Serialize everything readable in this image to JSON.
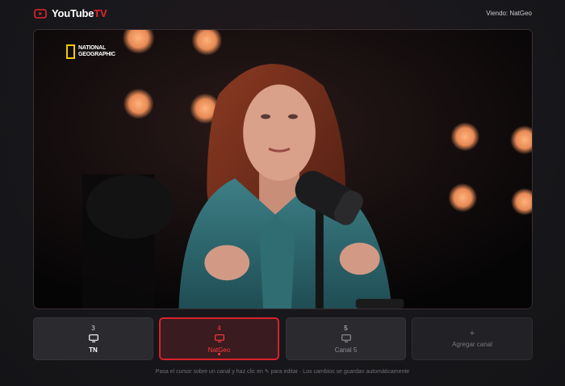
{
  "header": {
    "logo_main": "YouTube",
    "logo_accent": "TV",
    "now_viewing": "Viendo: NatGeo"
  },
  "player": {
    "channel_logo_line1": "NATIONAL",
    "channel_logo_line2": "GEOGRAPHIC"
  },
  "channels": [
    {
      "number": "3",
      "name": "TN",
      "icon": "tv-icon",
      "active": false
    },
    {
      "number": "4",
      "name": "NatGeo",
      "icon": "tv-icon",
      "active": true
    },
    {
      "number": "5",
      "name": "Canal 5",
      "icon": "tv-icon",
      "active": false
    }
  ],
  "add_channel": {
    "symbol": "+",
    "label": "Agregar canal"
  },
  "hint": "Pasa el cursor sobre un canal y haz clic en ✎ para editar · Los cambios se guardan automáticamente",
  "colors": {
    "accent": "#e4262b",
    "background": "#1a1a1e",
    "card": "#2a2a2f",
    "natgeo_yellow": "#f3c900"
  }
}
